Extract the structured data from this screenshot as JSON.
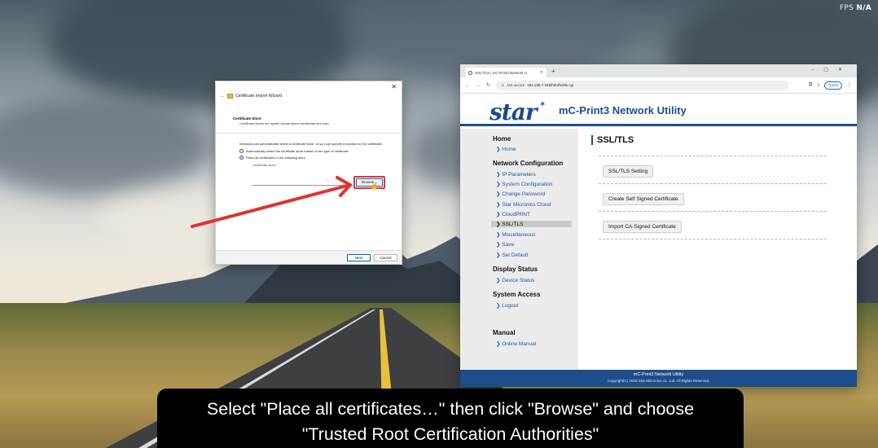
{
  "overlay": {
    "fps_label": "FPS",
    "fps_value": "N/A"
  },
  "wizard": {
    "title": "Certificate Import Wizard",
    "section_title": "Certificate Store",
    "section_desc": "Certificate stores are system areas where certificates are kept.",
    "body_text": "Windows can automatically select a certificate store, or you can specify a location for the certificate.",
    "option_auto": "Automatically select the certificate store based on the type of certificate",
    "option_place": "Place all certificates in the following store",
    "store_label": "Certificate store:",
    "browse_label": "Browse...",
    "next_label": "Next",
    "cancel_label": "Cancel"
  },
  "browser": {
    "tab_title": "SSL/TLS | mC-Print3 Network U",
    "not_secure": "Not secure",
    "url": "192.168.7.248/html/ssltls.cgi",
    "guest": "Guest"
  },
  "app": {
    "logo": "star",
    "title": "mC-Print3 Network Utility",
    "nav": {
      "home_group": "Home",
      "home": "Home",
      "network_group": "Network Configuration",
      "ip_parameters": "IP Parameters",
      "system_configuration": "System Configuration",
      "change_password": "Change Password",
      "star_micronics_cloud": "Star Micronics Cloud",
      "cloudprnt": "CloudPRNT",
      "ssl_tls": "SSL/TLS",
      "miscellaneous": "Miscellaneous",
      "save": "Save",
      "set_default": "Set Default",
      "display_group": "Display Status",
      "device_status": "Device Status",
      "system_access_group": "System Access",
      "logout": "Logout",
      "manual_group": "Manual",
      "online_manual": "Online Manual"
    },
    "content_title": "SSL/TLS",
    "buttons": {
      "ssl_setting": "SSL/TLS Setting",
      "create_self_signed": "Create Self Signed Certificate",
      "import_ca_signed": "Import CA-Signed Certificate"
    },
    "footer_line1": "mC-Print3 Network Utility",
    "footer_line2": "Copyright(C) 2018 Star Micronics co., Ltd. All Rights Reserved."
  },
  "caption": {
    "line1": "Select \"Place all certificates…\" then click \"Browse\" and choose",
    "line2": "\"Trusted Root Certification Authorities\""
  },
  "colors": {
    "brand_blue": "#1d4e89",
    "highlight_red": "#e03232",
    "link_blue": "#1a56a8"
  }
}
